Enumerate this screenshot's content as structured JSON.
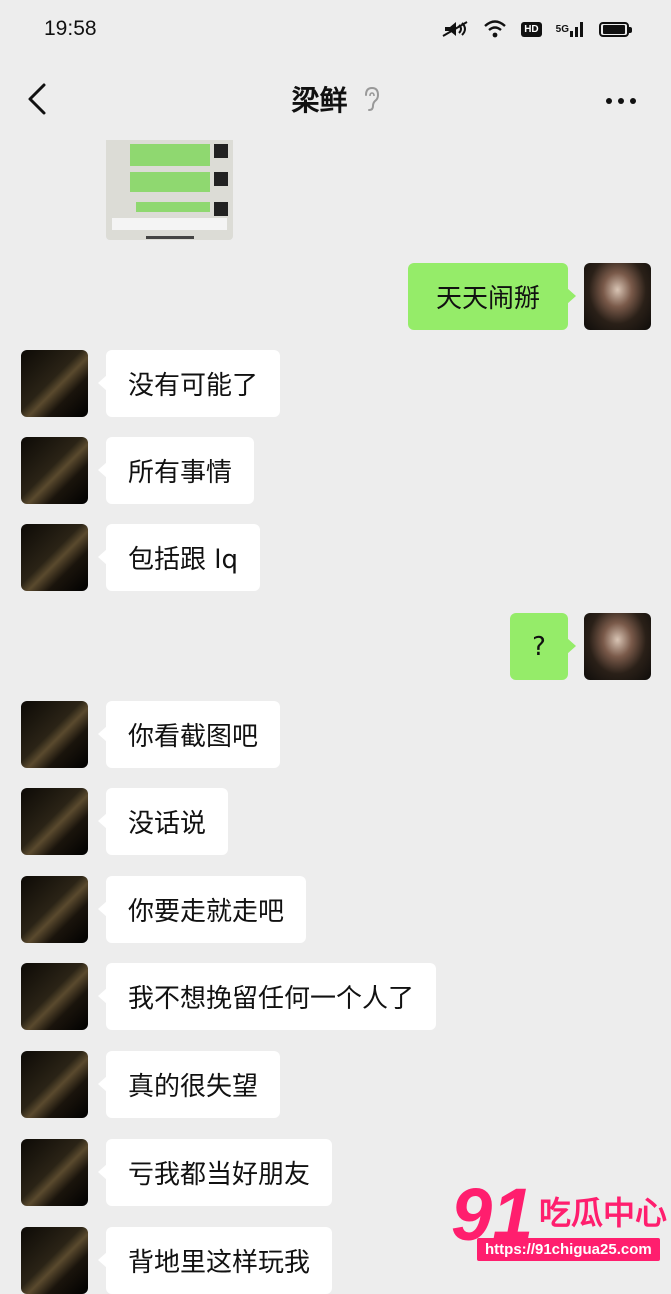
{
  "status_bar": {
    "time": "19:58",
    "icons": [
      "mute-icon",
      "wifi-icon",
      "hd-badge",
      "5g-signal-icon",
      "battery-icon"
    ],
    "hd_label": "HD",
    "network_label": "5G",
    "battery_level_fraction": 0.9
  },
  "header": {
    "title": "梁鲜",
    "back_icon": "chevron-left-icon",
    "ear_icon": "ear-icon",
    "more_icon": "more-icon"
  },
  "messages": [
    {
      "side": "out",
      "text": "天天闹掰"
    },
    {
      "side": "in",
      "text": "没有可能了"
    },
    {
      "side": "in",
      "text": "所有事情"
    },
    {
      "side": "in",
      "text": "包括跟 lq"
    },
    {
      "side": "out",
      "text": "?"
    },
    {
      "side": "in",
      "text": "你看截图吧"
    },
    {
      "side": "in",
      "text": "没话说"
    },
    {
      "side": "in",
      "text": "你要走就走吧"
    },
    {
      "side": "in",
      "text": "我不想挽留任何一个人了"
    },
    {
      "side": "in",
      "text": "真的很失望"
    },
    {
      "side": "in",
      "text": "亏我都当好朋友"
    },
    {
      "side": "in",
      "text": "背地里这样玩我"
    }
  ],
  "watermark": {
    "logo_number": "91",
    "logo_text": "吃瓜中心",
    "url": "https://91chigua25.com"
  },
  "colors": {
    "background": "#ededed",
    "bubble_out": "#95ec69",
    "bubble_in": "#ffffff",
    "watermark": "#ff1e6e"
  }
}
